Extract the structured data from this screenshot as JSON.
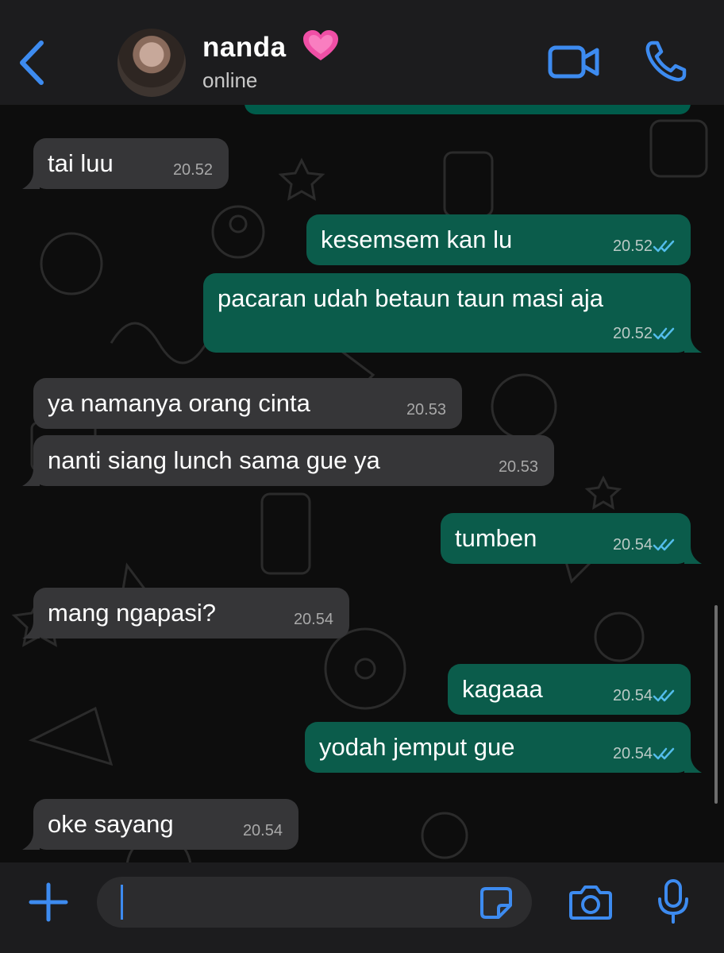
{
  "header": {
    "name": "nanda",
    "status": "online",
    "heart_emoji": "💗"
  },
  "colors": {
    "accent": "#3d8bf0",
    "incoming_bubble": "#363638",
    "outgoing_bubble": "#0b5c4b",
    "read_ticks": "#53bdeb"
  },
  "messages": [
    {
      "direction": "in",
      "text": "tai luu",
      "time": "20.52"
    },
    {
      "direction": "out",
      "text": "kesemsem kan lu",
      "time": "20.52",
      "status": "read"
    },
    {
      "direction": "out",
      "text": "pacaran udah betaun taun masi aja",
      "time": "20.52",
      "status": "read"
    },
    {
      "direction": "in",
      "text": "ya namanya orang cinta",
      "time": "20.53"
    },
    {
      "direction": "in",
      "text": "nanti siang lunch sama gue ya",
      "time": "20.53"
    },
    {
      "direction": "out",
      "text": "tumben",
      "time": "20.54",
      "status": "read"
    },
    {
      "direction": "in",
      "text": "mang ngapasi?",
      "time": "20.54"
    },
    {
      "direction": "out",
      "text": "kagaaa",
      "time": "20.54",
      "status": "read"
    },
    {
      "direction": "out",
      "text": "yodah jemput gue",
      "time": "20.54",
      "status": "read"
    },
    {
      "direction": "in",
      "text": "oke sayang",
      "time": "20.54"
    }
  ],
  "icons": {
    "back": "chevron-left-icon",
    "video": "video-camera-icon",
    "call": "phone-icon",
    "plus": "plus-icon",
    "sticker": "sticker-icon",
    "camera": "camera-icon",
    "mic": "microphone-icon"
  },
  "composer": {
    "value": ""
  }
}
